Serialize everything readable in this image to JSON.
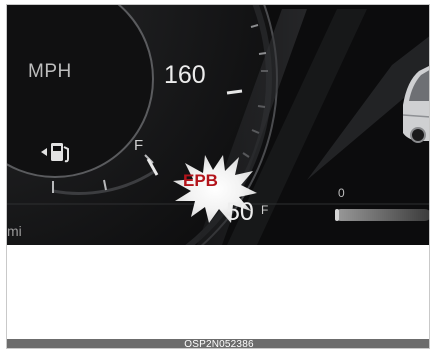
{
  "cluster": {
    "speed_unit": "MPH",
    "speed_mark": "160",
    "fuel_full": "F",
    "gauge_zero": "0",
    "temperature_value": "50",
    "temperature_unit": "F",
    "odometer_unit": "mi"
  },
  "warning": {
    "label": "EPB",
    "color": "#b3141b"
  },
  "icons": {
    "fuel": "fuel-pump-icon",
    "car": "car-icon"
  },
  "caption": {
    "code": "OSP2N052386"
  }
}
